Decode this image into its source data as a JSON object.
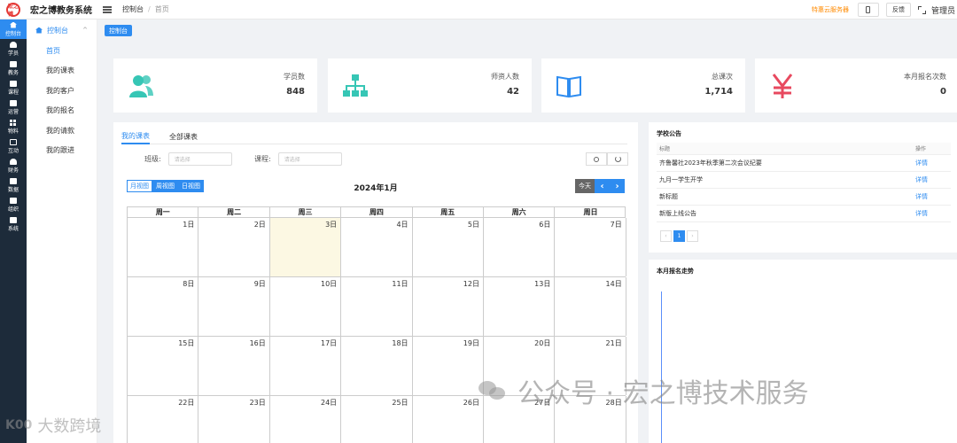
{
  "header": {
    "logo_text": "宏之博",
    "title": "宏之博教务系统",
    "breadcrumb": [
      "控制台",
      "首页"
    ],
    "promo": "特惠云服务器",
    "feedback_label": "反馈",
    "admin_label": "管理员"
  },
  "sidebar": {
    "items": [
      {
        "label": "控制台",
        "icon": "home-icon"
      },
      {
        "label": "学员",
        "icon": "user-icon"
      },
      {
        "label": "教务",
        "icon": "calendar-icon"
      },
      {
        "label": "课程",
        "icon": "book-icon"
      },
      {
        "label": "运营",
        "icon": "lock-icon"
      },
      {
        "label": "物料",
        "icon": "grid-icon"
      },
      {
        "label": "互动",
        "icon": "mail-icon"
      },
      {
        "label": "财务",
        "icon": "person-icon"
      },
      {
        "label": "数据",
        "icon": "database-icon"
      },
      {
        "label": "组织",
        "icon": "org-icon"
      },
      {
        "label": "系统",
        "icon": "monitor-icon"
      }
    ]
  },
  "submenu": {
    "title": "控制台",
    "items": [
      "首页",
      "我的课表",
      "我的客户",
      "我的报名",
      "我的请款",
      "我的跟进"
    ]
  },
  "tab": {
    "label": "控制台"
  },
  "stats": [
    {
      "label": "学员数",
      "value": "848",
      "icon": "users-icon",
      "color": "#36c6b5"
    },
    {
      "label": "师资人数",
      "value": "42",
      "icon": "org-chart-icon",
      "color": "#36c6b5"
    },
    {
      "label": "总课次",
      "value": "1,714",
      "icon": "open-book-icon",
      "color": "#2e8cf0"
    },
    {
      "label": "本月报名次数",
      "value": "0",
      "icon": "yen-icon",
      "color": "#e8495f"
    }
  ],
  "calendar": {
    "tabs": [
      "我的课表",
      "全部课表"
    ],
    "class_label": "班级:",
    "class_placeholder": "请选择",
    "course_label": "课程:",
    "course_placeholder": "请选择",
    "views": [
      "月视图",
      "周视图",
      "日视图"
    ],
    "title": "2024年1月",
    "today_label": "今天",
    "weekdays": [
      "周一",
      "周二",
      "周三",
      "周四",
      "周五",
      "周六",
      "周日"
    ],
    "weeks": [
      [
        "1日",
        "2日",
        "3日",
        "4日",
        "5日",
        "6日",
        "7日"
      ],
      [
        "8日",
        "9日",
        "10日",
        "11日",
        "12日",
        "13日",
        "14日"
      ],
      [
        "15日",
        "16日",
        "17日",
        "18日",
        "19日",
        "20日",
        "21日"
      ],
      [
        "22日",
        "23日",
        "24日",
        "25日",
        "26日",
        "27日",
        "28日"
      ]
    ]
  },
  "notice": {
    "title": "学校公告",
    "col_title": "标题",
    "col_action": "操作",
    "rows": [
      {
        "title": "齐鲁馨社2023年秋季第二次会议纪要",
        "action": "详情"
      },
      {
        "title": "九月一学生开学",
        "action": "详情"
      },
      {
        "title": "新标题",
        "action": "详情"
      },
      {
        "title": "新版上线公告",
        "action": "详情"
      }
    ],
    "page": "1"
  },
  "trend": {
    "title": "本月报名走势"
  },
  "watermarks": {
    "main": "公众号 · 宏之博技术服务",
    "corner_mark": "K00",
    "corner": "大数跨境"
  }
}
